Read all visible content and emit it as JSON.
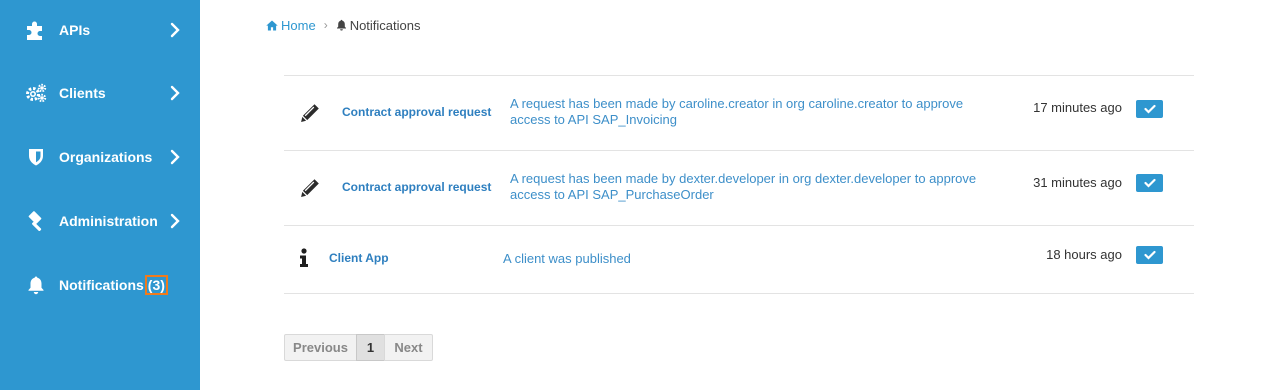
{
  "sidebar": {
    "items": [
      {
        "label": "APIs",
        "icon": "puzzle-icon"
      },
      {
        "label": "Clients",
        "icon": "cogs-icon"
      },
      {
        "label": "Organizations",
        "icon": "shield-icon"
      },
      {
        "label": "Administration",
        "icon": "gavel-icon"
      },
      {
        "label": "Notifications",
        "icon": "bell-icon",
        "badge": "(3)"
      }
    ]
  },
  "breadcrumb": {
    "home": "Home",
    "current": "Notifications"
  },
  "notifications": [
    {
      "icon": "pencil-icon",
      "type": "Contract approval request",
      "message": "A request has been made by caroline.creator in org caroline.creator to approve access to API SAP_Invoicing",
      "time": "17 minutes ago"
    },
    {
      "icon": "pencil-icon",
      "type": "Contract approval request",
      "message": "A request has been made by dexter.developer in org dexter.developer to approve access to API SAP_PurchaseOrder",
      "time": "31 minutes ago"
    },
    {
      "icon": "info-icon",
      "type": "Client App",
      "message": "A client was published",
      "time": "18 hours ago"
    }
  ],
  "pagination": {
    "previous": "Previous",
    "current": "1",
    "next": "Next"
  },
  "colors": {
    "sidebar": "#2e97d0",
    "accent": "#2e97d0",
    "badge_border": "#f07b1c"
  }
}
